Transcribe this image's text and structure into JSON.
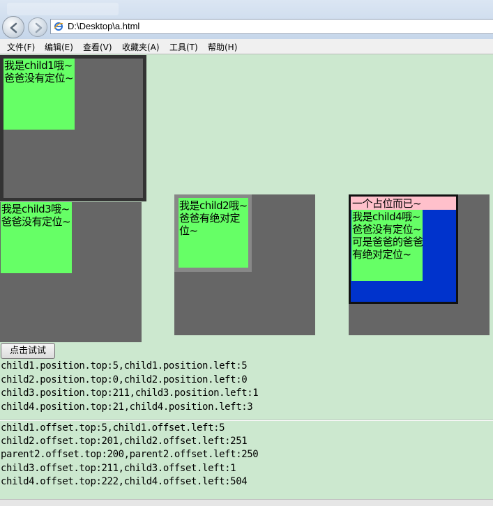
{
  "browser": {
    "address": "D:\\Desktop\\a.html",
    "menu": [
      "文件(F)",
      "编辑(E)",
      "查看(V)",
      "收藏夹(A)",
      "工具(T)",
      "帮助(H)"
    ]
  },
  "boxes": {
    "child1_text": "我是child1哦~爸爸没有定位~",
    "child2_text": "我是child2哦~爸爸有绝对定位~",
    "child3_text": "我是child3哦~爸爸没有定位~",
    "placeholder4_text": "一个占位而已~",
    "child4_text": "我是child4哦~爸爸没有定位~可是爸爸的爸爸有绝对定位~"
  },
  "button_label": "点击试试",
  "position_lines": [
    "child1.position.top:5,child1.position.left:5",
    "child2.position.top:0,child2.position.left:0",
    "child3.position.top:211,child3.position.left:1",
    "child4.position.top:21,child4.position.left:3"
  ],
  "offset_lines": [
    "child1.offset.top:5,child1.offset.left:5",
    "child2.offset.top:201,child2.offset.left:251",
    "parent2.offset.top:200,parent2.offset.left:250",
    "child3.offset.top:211,child3.offset.left:1",
    "child4.offset.top:222,child4.offset.left:504"
  ],
  "colors": {
    "page_bg": "#cce8cf",
    "parent_gray": "#666666",
    "child_green": "#66ff66",
    "inner_blue": "#0033cc",
    "placeholder_pink": "#ffc0cb"
  }
}
